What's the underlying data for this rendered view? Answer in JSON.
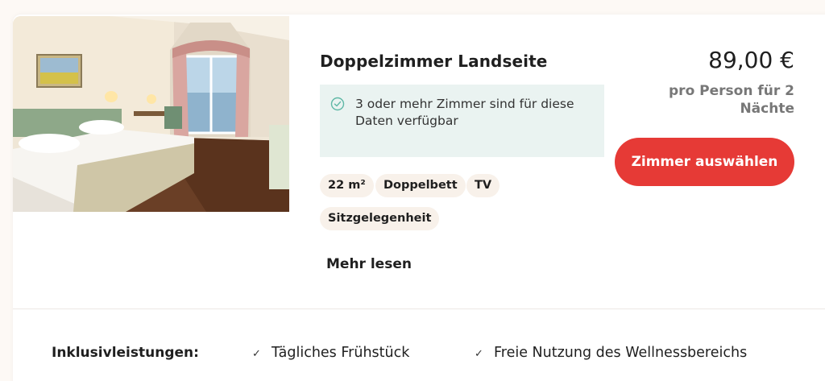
{
  "room": {
    "title": "Doppelzimmer Landseite",
    "availability_text": "3 oder mehr Zimmer sind für diese Daten verfügbar",
    "features": [
      "22 m²",
      "Doppelbett",
      "TV",
      "Sitzgelegenheit"
    ],
    "more_label": "Mehr lesen"
  },
  "pricing": {
    "price": "89,00 €",
    "per_label": "pro Person für 2 Nächte",
    "select_label": "Zimmer auswählen"
  },
  "inclusions": {
    "label": "Inklusivleistungen:",
    "items": [
      "Tägliches Frühstück",
      "Freie Nutzung des Wellnessbereichs"
    ]
  },
  "colors": {
    "accent": "#e63a36",
    "availability_bg": "#eaf3f1",
    "chip_bg": "#f8f1ea",
    "check": "#5fb8a6"
  },
  "icons": {
    "availability": "check-circle-icon",
    "inclusion": "check-icon"
  }
}
